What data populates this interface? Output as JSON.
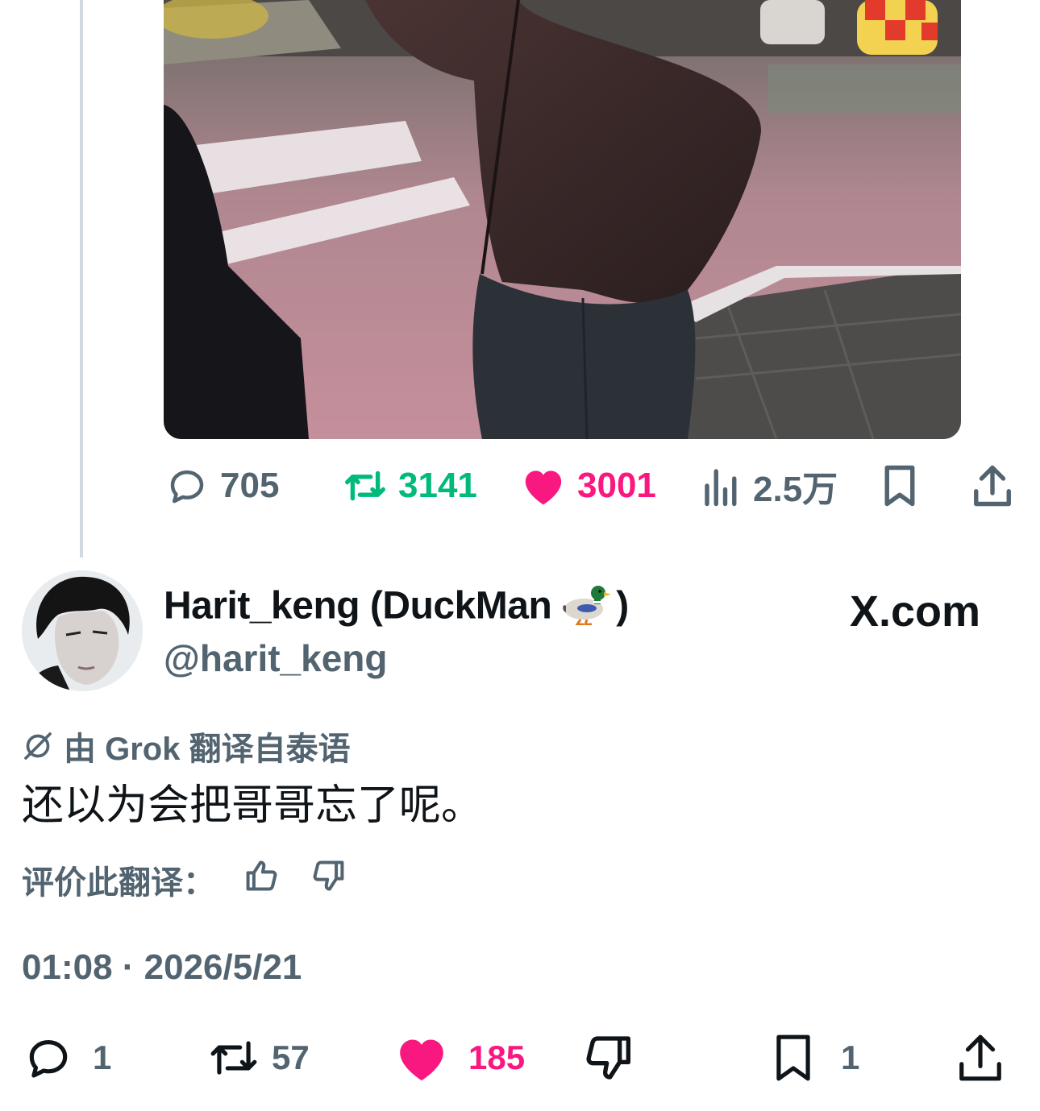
{
  "previous_tweet": {
    "stats": {
      "replies": "705",
      "retweets": "3141",
      "likes": "3001",
      "views": "2.5万"
    }
  },
  "tweet": {
    "display_name": "Harit_keng (DuckMan",
    "display_name_close": ")",
    "handle": "@harit_keng",
    "source_badge": "X.com",
    "translation_note": "由 Grok 翻译自泰语",
    "text": "还以为会把哥哥忘了呢。",
    "rate_label": "评价此翻译：",
    "timestamp": "01:08 · 2026/5/21",
    "stats": {
      "replies": "1",
      "retweets": "57",
      "likes": "185",
      "bookmarks": "1"
    }
  },
  "colors": {
    "retweet_green": "#00ba7c",
    "like_pink": "#f91880",
    "secondary_text": "#536471"
  },
  "icons": [
    "reply-icon",
    "retweet-icon",
    "heart-icon",
    "views-icon",
    "bookmark-icon",
    "share-icon",
    "grok-icon",
    "thumbs-up-icon",
    "thumbs-down-icon",
    "duck-emoji"
  ]
}
